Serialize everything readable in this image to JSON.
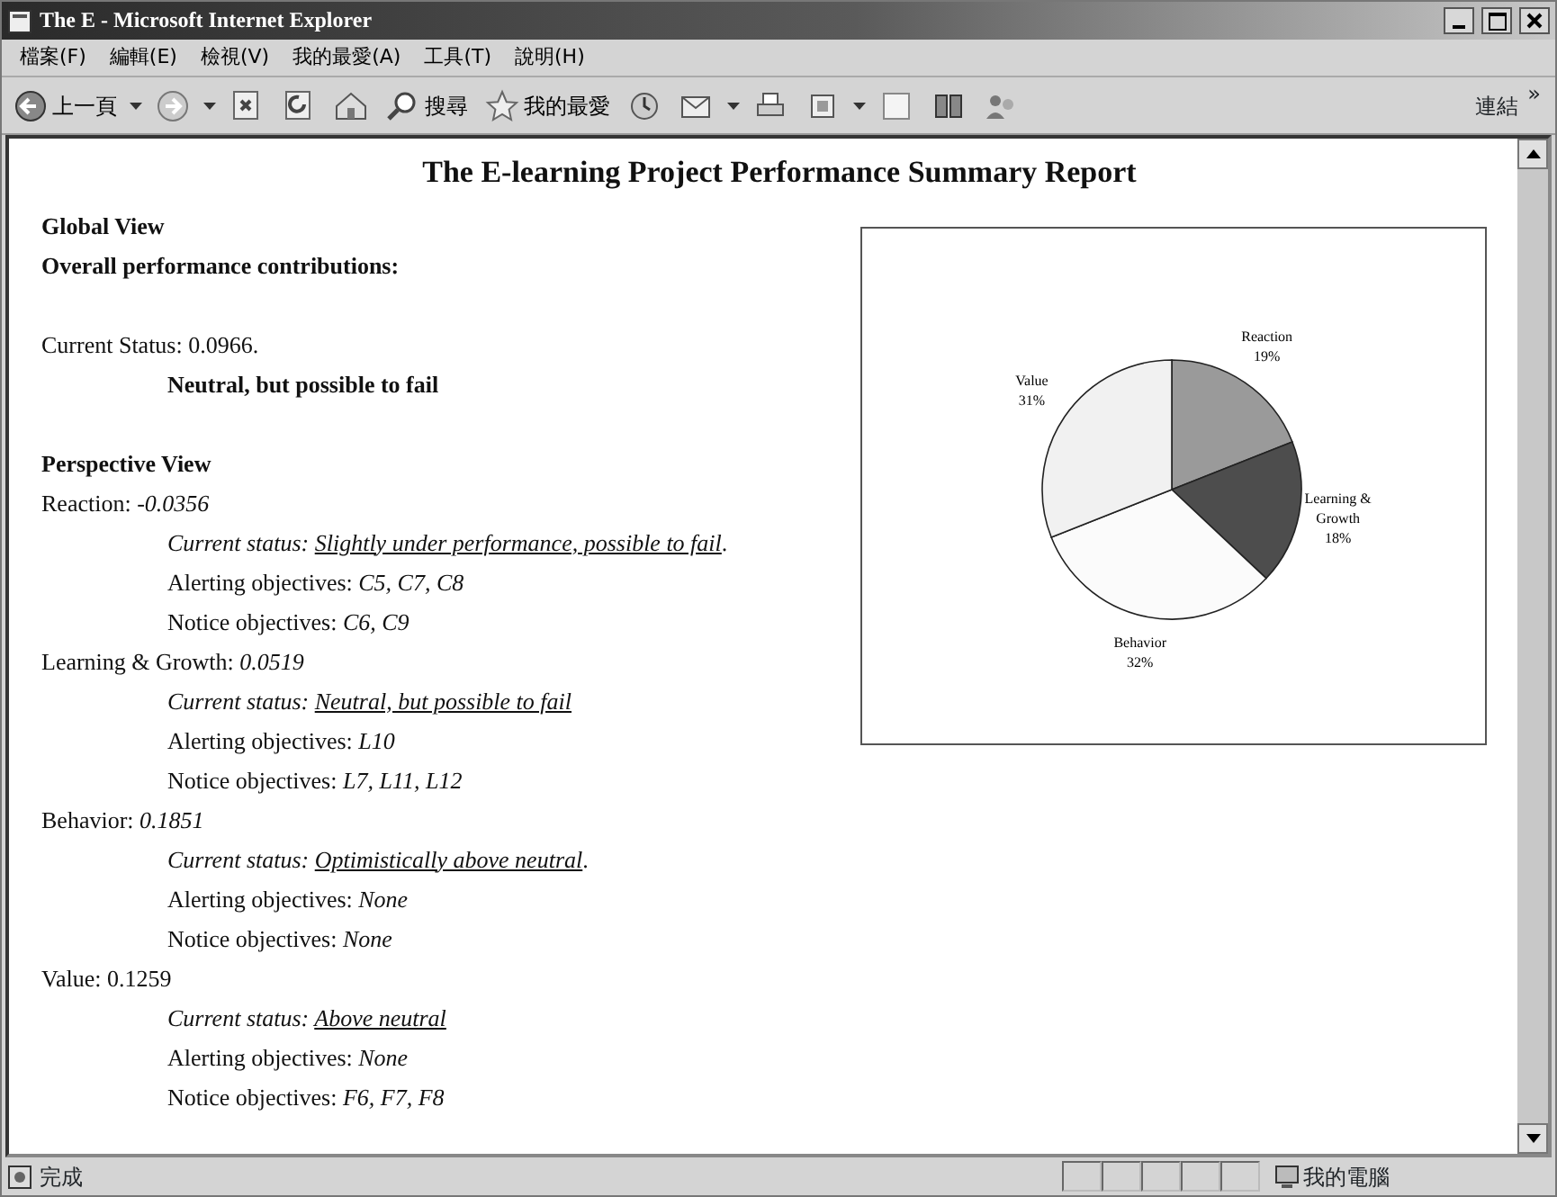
{
  "window": {
    "title": "The E - Microsoft Internet Explorer"
  },
  "menu": [
    "檔案(F)",
    "編輯(E)",
    "檢視(V)",
    "我的最愛(A)",
    "工具(T)",
    "說明(H)"
  ],
  "toolbar": [
    {
      "kind": "back",
      "label": "上一頁"
    },
    {
      "kind": "forward"
    },
    {
      "kind": "stop"
    },
    {
      "kind": "refresh"
    },
    {
      "kind": "home"
    },
    {
      "kind": "search",
      "label": "搜尋"
    },
    {
      "kind": "favorites",
      "label": "我的最愛"
    },
    {
      "kind": "history"
    },
    {
      "kind": "mail"
    },
    {
      "kind": "print"
    },
    {
      "kind": "edit"
    },
    {
      "kind": "blank"
    },
    {
      "kind": "discuss"
    },
    {
      "kind": "people"
    }
  ],
  "links": {
    "label": "連結",
    "more": "»"
  },
  "report": {
    "title": "The E-learning Project Performance Summary Report",
    "global_heading": "Global View",
    "overall_label": "Overall performance contributions:",
    "current_status": "Current Status: 0.0966.",
    "verdict": "Neutral, but possible to fail",
    "perspective_heading": "Perspective View",
    "perspectives": [
      {
        "name": "Reaction:",
        "value": "-0.0356",
        "italic_value": true,
        "status_label": "Current status:",
        "status": "Slightly under performance, possible to fail",
        "status_end": ".",
        "alerting_label": "Alerting objectives:",
        "alerting": "C5, C7, C8",
        "notice_label": "Notice objectives:",
        "notice": "C6, C9"
      },
      {
        "name": "Learning & Growth:",
        "value": "0.0519",
        "italic_value": true,
        "status_label": "Current status:",
        "status": "Neutral, but possible to fail",
        "alerting_label": "Alerting objectives:",
        "alerting": "L10",
        "notice_label": "Notice objectives:",
        "notice": "L7, L11, L12"
      },
      {
        "name": "Behavior:",
        "value": "0.1851",
        "italic_value": true,
        "status_label": "Current status:",
        "status": "Optimistically above neutral",
        "status_end": ".",
        "alerting_label": "Alerting objectives:",
        "alerting": "None",
        "notice_label": "Notice objectives:",
        "notice": "None"
      },
      {
        "name": "Value:",
        "value": "0.1259",
        "italic_value": false,
        "status_label": "Current status:",
        "status": "Above neutral",
        "alerting_label": "Alerting objectives:",
        "alerting": "None",
        "notice_label": "Notice objectives:",
        "notice": "F6, F7, F8"
      }
    ],
    "chart_data": {
      "type": "pie",
      "categories": [
        "Reaction",
        "Learning & Growth",
        "Behavior",
        "Value"
      ],
      "series": [
        {
          "values": [
            19,
            18,
            32,
            31
          ]
        }
      ],
      "colors": [
        "#9a9a9a",
        "#4d4d4d",
        "#fbfbfb",
        "#f1f1f1"
      ],
      "value_labels": [
        "19%",
        "18%",
        "32%",
        "31%"
      ]
    }
  },
  "status_bar": {
    "text": "完成",
    "zone": "我的電腦"
  }
}
